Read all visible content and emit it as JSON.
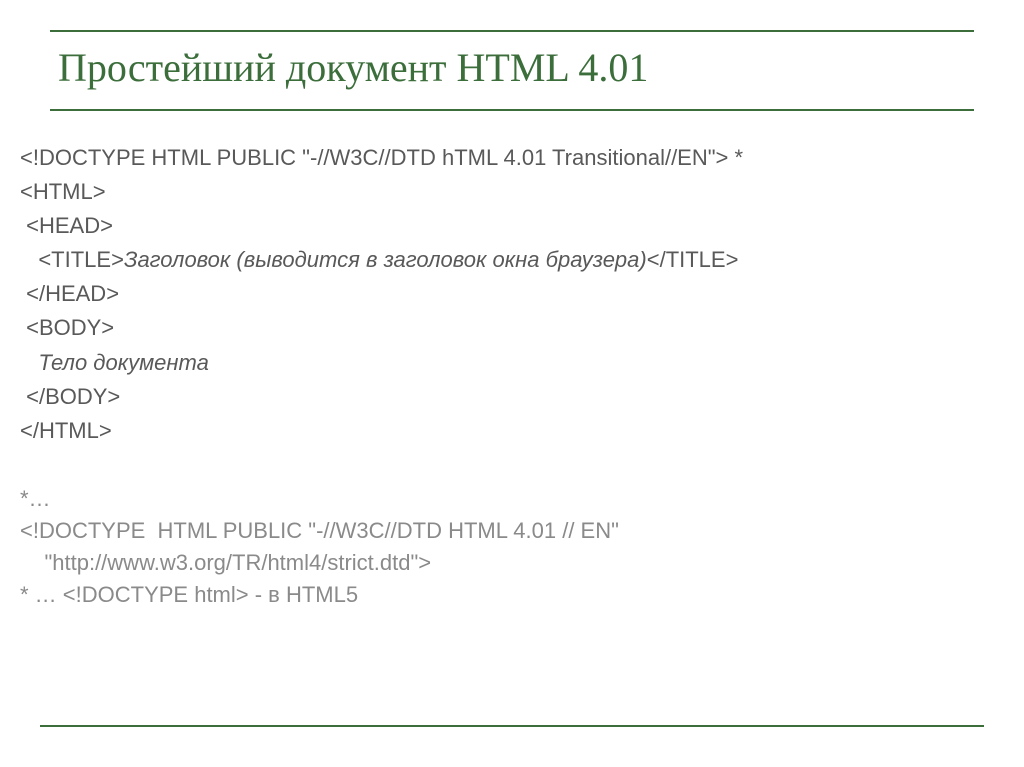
{
  "slide": {
    "title": "Простейший документ HTML 4.01",
    "code": {
      "line1": "<!DOCTYPE HTML PUBLIC \"-//W3C//DTD hTML 4.01 Transitional//EN\">",
      "line1_asterisk": " *",
      "line2": "<HTML>",
      "line3": " <HEAD>",
      "line4_pre": "   <TITLE>",
      "line4_italic": "Заголовок (выводится в заголовок окна браузера)",
      "line4_post": "</TITLE>",
      "line5": " </HEAD>",
      "line6": " <BODY>",
      "line7_pre": "   ",
      "line7_italic": "Тело документа",
      "line8": " </BODY>",
      "line9": "</HTML>"
    },
    "footer": {
      "line1": "*…",
      "line2": "<!DOCTYPE  HTML PUBLIC \"-//W3C//DTD HTML 4.01 // EN\"",
      "line3": "    \"http://www.w3.org/TR/html4/strict.dtd\">",
      "line4": "* … <!DOCTYPE html> - в HTML5"
    }
  }
}
